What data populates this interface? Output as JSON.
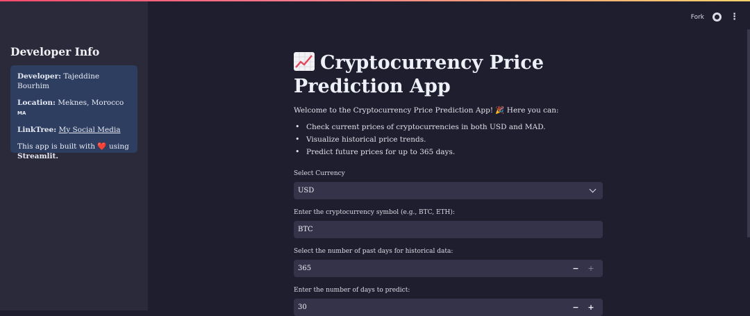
{
  "toolbar": {
    "fork_label": "Fork"
  },
  "sidebar": {
    "title": "Developer Info",
    "developer_label": "Developer:",
    "developer_value": "Tajeddine Bourhim",
    "location_label": "Location:",
    "location_value": "Meknes, Morocco",
    "location_flag": "MA",
    "linktree_label": "LinkTree:",
    "linktree_value": "My Social Media",
    "built_prefix": "This app is built with",
    "built_heart": "❤️",
    "built_using": "using",
    "built_tool": "Streamlit."
  },
  "main": {
    "title_line1": "Cryptocurrency Price",
    "title_line2": "Prediction App",
    "intro": "Welcome to the Cryptocurrency Price Prediction App! 🎉 Here you can:",
    "features": [
      "Check current prices of cryptocurrencies in both USD and MAD.",
      "Visualize historical price trends.",
      "Predict future prices for up to 365 days."
    ],
    "currency": {
      "label": "Select Currency",
      "value": "USD"
    },
    "symbol": {
      "label": "Enter the cryptocurrency symbol (e.g., BTC, ETH):",
      "value": "BTC"
    },
    "past_days": {
      "label": "Select the number of past days for historical data:",
      "value": "365",
      "minus": "−",
      "plus": "+"
    },
    "predict_days": {
      "label": "Enter the number of days to predict:",
      "value": "30",
      "minus": "−",
      "plus": "+"
    }
  },
  "colors": {
    "sidebar_bg": "#2b2a3b",
    "main_bg": "#1f1e2e",
    "info_box_bg": "#2e3e60",
    "input_bg": "#34334a"
  }
}
